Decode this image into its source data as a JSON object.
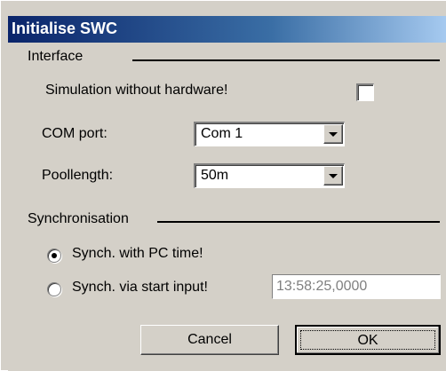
{
  "window": {
    "title": "Initialise SWC"
  },
  "interface": {
    "group_label": "Interface",
    "simulation_label": "Simulation without hardware!",
    "simulation_checked": false,
    "com_port_label": "COM port:",
    "com_port_value": "Com 1",
    "poollength_label": "Poollength:",
    "poollength_value": "50m"
  },
  "synchronisation": {
    "group_label": "Synchronisation",
    "option_pc_time_label": "Synch. with PC time!",
    "option_pc_time_selected": true,
    "option_start_input_label": "Synch. via start input!",
    "option_start_input_selected": false,
    "start_time_value": "13:58:25,0000"
  },
  "buttons": {
    "cancel_label": "Cancel",
    "ok_label": "OK"
  },
  "colors": {
    "dialog_bg": "#d4d0c8",
    "title_gradient_start": "#0a246a",
    "title_gradient_end": "#a6caf0",
    "title_text": "#ffffff"
  }
}
